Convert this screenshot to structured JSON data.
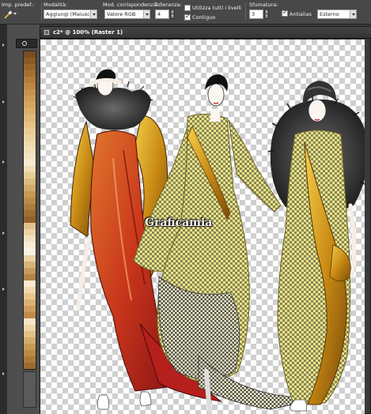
{
  "toolbar": {
    "preset_label": "Imp. predef.:",
    "mode_label": "Modalità:",
    "mode_value": "Aggiungi (Maiusc)",
    "match_label": "Mod. corrispondenza:",
    "match_value": "Valore RGB",
    "tolerance_label": "Tolleranza:",
    "tolerance_value": "4",
    "all_layers_label": "Utilizza tutti i livelli",
    "all_layers_checked": false,
    "contiguous_label": "Contiguo",
    "contiguous_checked": true,
    "feather_label": "Sfumatura:",
    "feather_value": "3",
    "antialias_label": "Antialias",
    "antialias_checked": true,
    "antialias_mode_value": "Esterno"
  },
  "document": {
    "title": "c2* @ 100% (Raster 1)",
    "watermark": "Graficamia"
  },
  "palette_colors": [
    "#7a4e22",
    "#8a5a27",
    "#98652d",
    "#a57034",
    "#b27c3b",
    "#bd8744",
    "#c6924e",
    "#cd9c58",
    "#d3a662",
    "#d9b06e",
    "#dfba7a",
    "#e4c387",
    "#e8cb94",
    "#ecd2a0",
    "#efd9ad",
    "#f2dfb9",
    "#f4e4c4",
    "#f6e9cf",
    "#f0ddb6",
    "#e6cd9a",
    "#dbbb80",
    "#d0aa69",
    "#c49a57",
    "#b88b49",
    "#ab7c3d",
    "#9d6e33",
    "#8f612b",
    "#e1c18c",
    "#ebd3a8",
    "#f2e2c2",
    "#f7ecd6",
    "#f9f1e2",
    "#e9d1a3",
    "#d7b47c",
    "#c59a5c",
    "#b48446",
    "#fae9d0",
    "#f3d9b0",
    "#e9c68e",
    "#dcb173",
    "#cf9e5e",
    "#c08b4c",
    "#f5e6c9",
    "#ecd5a6",
    "#e1c185",
    "#d5ad6b",
    "#c89a57",
    "#ba8947",
    "#ab7939",
    "#9c6a2e"
  ],
  "colors": {
    "toolbar_bg": "#484848",
    "panel_bg": "#4e4e4e",
    "window_bg": "#2a2a2a"
  }
}
